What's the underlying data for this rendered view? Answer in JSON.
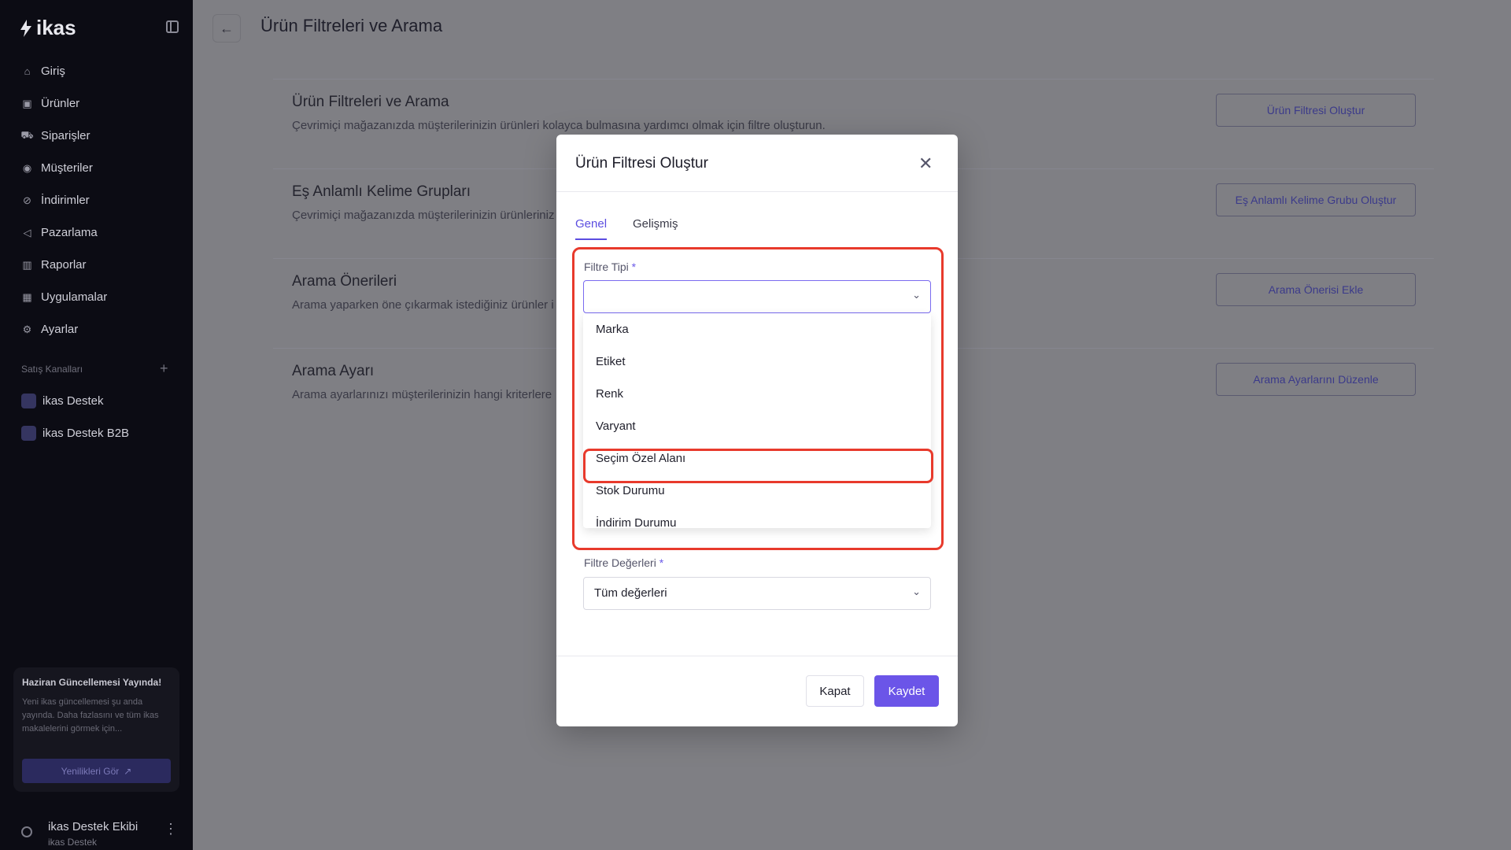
{
  "sidebar": {
    "logo_text": "ikas",
    "nav": [
      {
        "label": "Giriş",
        "icon": "home-icon"
      },
      {
        "label": "Ürünler",
        "icon": "box-icon"
      },
      {
        "label": "Siparişler",
        "icon": "cart-icon"
      },
      {
        "label": "Müşteriler",
        "icon": "user-circle-icon"
      },
      {
        "label": "İndirimler",
        "icon": "discount-icon"
      },
      {
        "label": "Pazarlama",
        "icon": "megaphone-icon"
      },
      {
        "label": "Raporlar",
        "icon": "chart-icon"
      },
      {
        "label": "Uygulamalar",
        "icon": "grid-icon"
      },
      {
        "label": "Ayarlar",
        "icon": "gear-icon"
      }
    ],
    "sales_channels_label": "Satış Kanalları",
    "channels": [
      {
        "label": "ikas Destek"
      },
      {
        "label": "ikas Destek B2B"
      }
    ],
    "update_card": {
      "title": "Haziran Güncellemesi Yayında!",
      "text": "Yeni ikas güncellemesi şu anda yayında. Daha fazlasını ve tüm ikas makalelerini görmek için...",
      "button": "Yenilikleri Gör"
    },
    "user": {
      "name": "ikas Destek Ekibi",
      "store": "ikas Destek"
    }
  },
  "header": {
    "title": "Ürün Filtreleri ve Arama"
  },
  "cards": [
    {
      "title": "Ürün Filtreleri ve Arama",
      "desc": "Çevrimiçi mağazanızda müşterilerinizin ürünleri kolayca bulmasına yardımcı olmak için filtre oluşturun.",
      "button": "Ürün Filtresi Oluştur"
    },
    {
      "title": "Eş Anlamlı Kelime Grupları",
      "desc": "Çevrimiçi mağazanızda müşterilerinizin ürünleriniz",
      "button": "Eş Anlamlı Kelime Grubu Oluştur"
    },
    {
      "title": "Arama Önerileri",
      "desc": "Arama yaparken öne çıkarmak istediğiniz ürünler i",
      "button": "Arama Önerisi Ekle"
    },
    {
      "title": "Arama Ayarı",
      "desc": "Arama ayarlarınızı müşterilerinizin hangi kriterlere",
      "button": "Arama Ayarlarını Düzenle"
    }
  ],
  "modal": {
    "title": "Ürün Filtresi Oluştur",
    "tabs": [
      "Genel",
      "Gelişmiş"
    ],
    "filter_type_label": "Filtre Tipi",
    "filter_type_value": "",
    "options": [
      "Marka",
      "Etiket",
      "Renk",
      "Varyant",
      "Seçim Özel Alanı",
      "Stok Durumu",
      "İndirim Durumu"
    ],
    "filter_values_label": "Filtre Değerleri",
    "filter_values_value": "Tüm değerleri",
    "close_button": "Kapat",
    "save_button": "Kaydet"
  },
  "colors": {
    "accent": "#6b55e8",
    "highlight": "#e83a2c",
    "sidebar_bg": "#0c0c14"
  }
}
